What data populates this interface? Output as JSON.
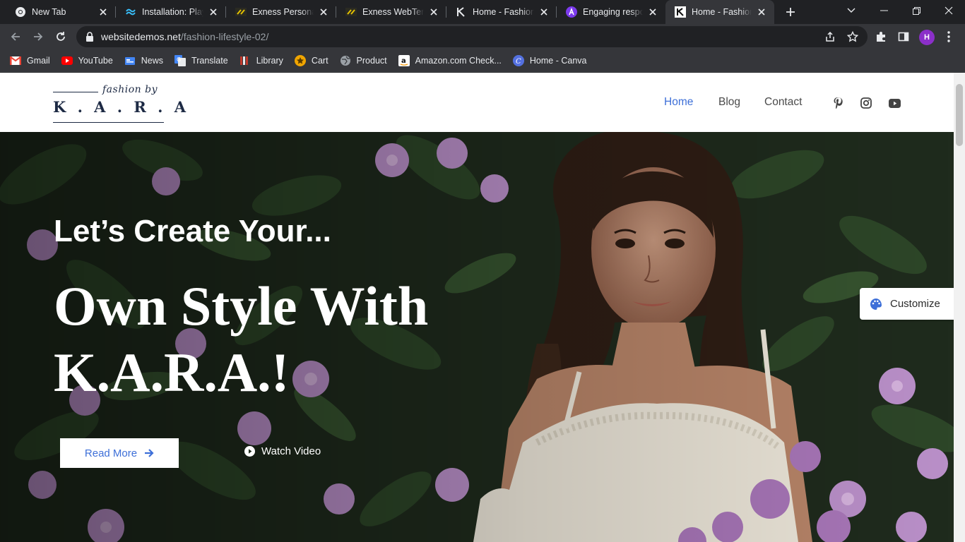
{
  "browser": {
    "tabs": [
      {
        "title": "New Tab",
        "icon": "chrome-icon"
      },
      {
        "title": "Installation: Play Console",
        "icon": "tailwind-icon"
      },
      {
        "title": "Exness Personal Area",
        "icon": "exness-icon"
      },
      {
        "title": "Exness WebTerminal",
        "icon": "exness-icon"
      },
      {
        "title": "Home - Fashion Lifestyle",
        "icon": "k-icon"
      },
      {
        "title": "Engaging responses",
        "icon": "arc-icon"
      },
      {
        "title": "Home - Fashion Lifestyle",
        "icon": "k-icon",
        "active": true
      }
    ],
    "url_domain": "websitedemos.net",
    "url_path": "/fashion-lifestyle-02/",
    "profile_initial": "H",
    "bookmarks": [
      {
        "label": "Gmail",
        "icon": "gmail-icon"
      },
      {
        "label": "YouTube",
        "icon": "youtube-icon"
      },
      {
        "label": "News",
        "icon": "news-icon"
      },
      {
        "label": "Translate",
        "icon": "translate-icon"
      },
      {
        "label": "Library",
        "icon": "library-icon"
      },
      {
        "label": "Cart",
        "icon": "cart-icon"
      },
      {
        "label": "Product",
        "icon": "globe-icon"
      },
      {
        "label": "Amazon.com Check...",
        "icon": "amazon-icon"
      },
      {
        "label": "Home - Canva",
        "icon": "canva-icon"
      }
    ]
  },
  "site": {
    "logo": {
      "script": "fashion by",
      "word": "K . A . R . A"
    },
    "nav": [
      {
        "label": "Home",
        "active": true
      },
      {
        "label": "Blog"
      },
      {
        "label": "Contact"
      }
    ],
    "social_icons": [
      "pinterest-icon",
      "instagram-icon",
      "youtube-icon"
    ],
    "hero": {
      "subtitle": "Let’s Create Your...",
      "title_line1": "Own Style With",
      "title_line2": "K.A.R.A.!",
      "primary_button": "Read More",
      "secondary_button": "Watch Video"
    },
    "customize_label": "Customize"
  },
  "colors": {
    "accent": "#3d6fd8",
    "logo": "#1d2a44",
    "chrome_dark": "#202124",
    "chrome_toolbar": "#35363a"
  }
}
